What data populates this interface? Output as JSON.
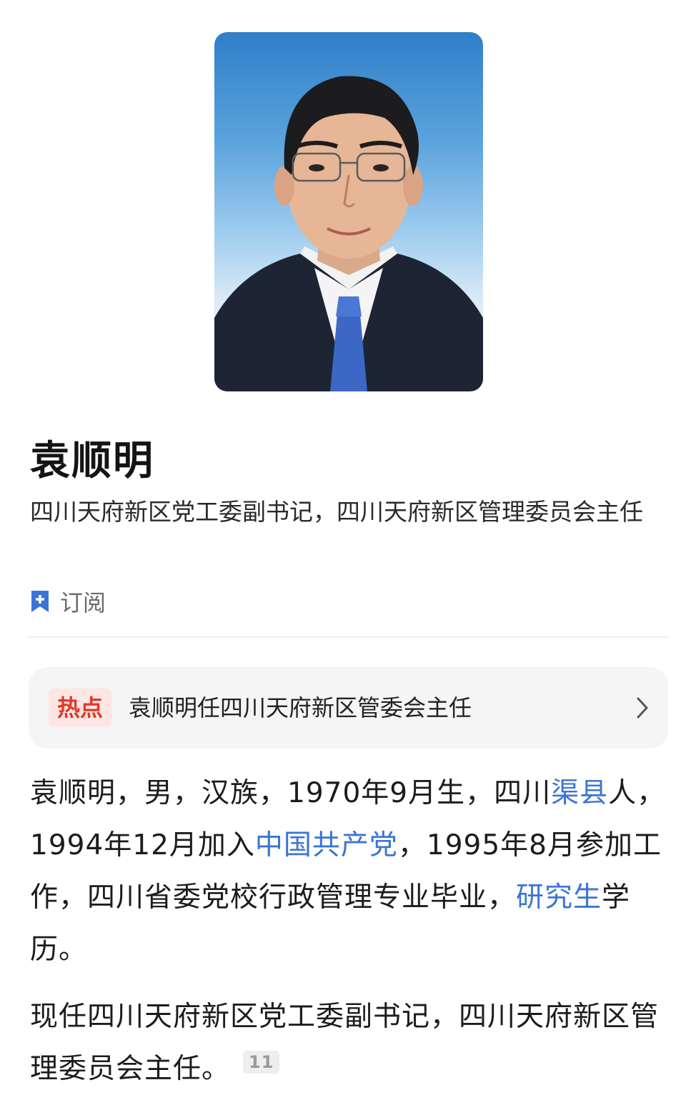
{
  "profile": {
    "name": "袁顺明",
    "title": "四川天府新区党工委副书记，四川天府新区管理委员会主任"
  },
  "subscribe": {
    "icon": "bookmark-plus-icon",
    "label": "订阅"
  },
  "hotspot": {
    "badge": "热点",
    "text": "袁顺明任四川天府新区管委会主任",
    "icon": "chevron-right-icon"
  },
  "bio": {
    "p1_a": "袁顺明，男，汉族，1970年9月生，四川",
    "p1_link1": "渠县",
    "p1_b": "人，1994年12月加入",
    "p1_link2": "中国共产党",
    "p1_c": "，1995年8月参加工作，四川省委党校行政管理专业毕业，",
    "p1_link3": "研究生",
    "p1_d": "学历。",
    "p2": "现任四川天府新区党工委副书记，四川天府新区管理委员会主任。",
    "citation": "11"
  },
  "colors": {
    "link": "#3b74d6",
    "hot_badge_text": "#e0382b",
    "hot_badge_bg": "#fde6e3"
  }
}
